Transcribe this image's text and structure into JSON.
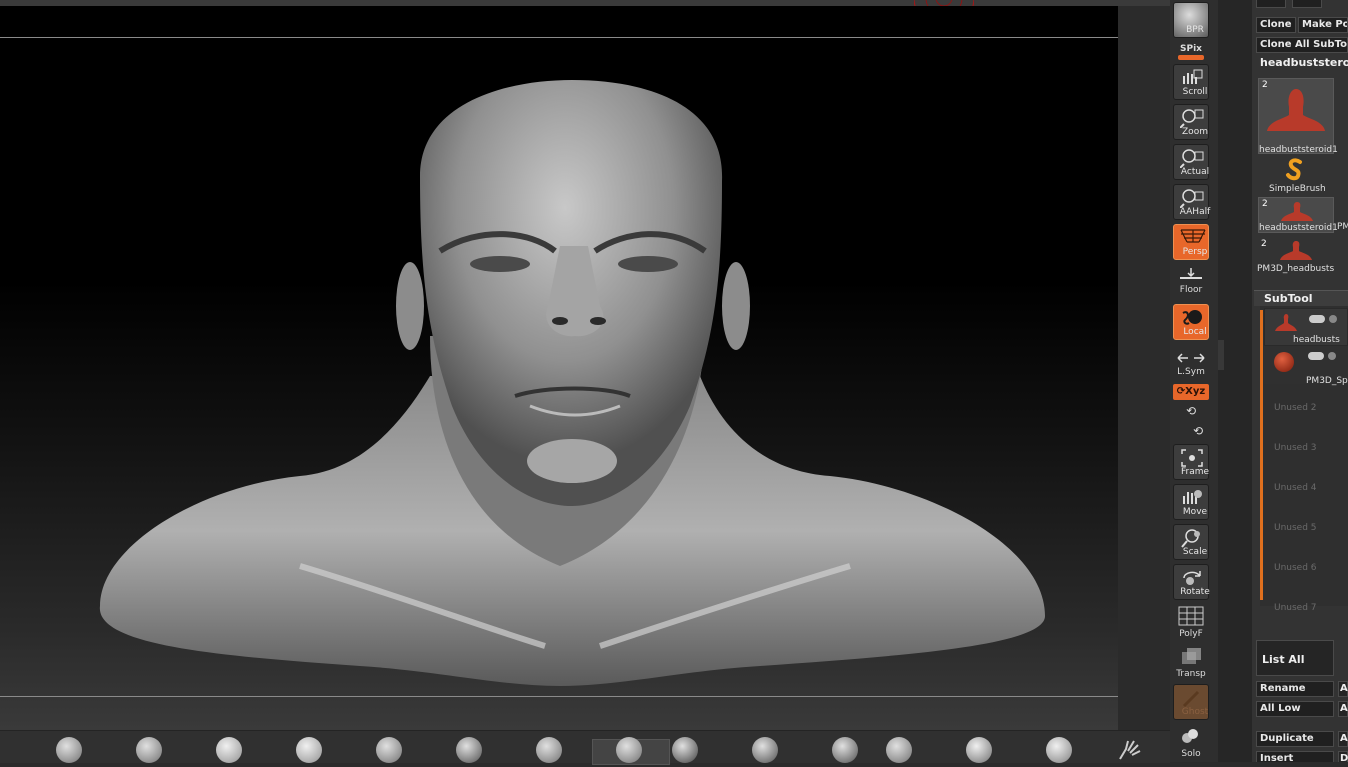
{
  "shelf": {
    "bpr_label": "BPR",
    "spix_label": "SPix",
    "buttons": [
      {
        "label": "Scroll",
        "icon": "scroll-icon"
      },
      {
        "label": "Zoom",
        "icon": "zoom-icon"
      },
      {
        "label": "Actual",
        "icon": "actual-icon"
      },
      {
        "label": "AAHalf",
        "icon": "aahalf-icon"
      },
      {
        "label": "Persp",
        "icon": "perspective-icon",
        "active": true
      },
      {
        "label": "Floor",
        "icon": "floor-icon"
      },
      {
        "label": "Local",
        "icon": "local-icon",
        "active": true
      },
      {
        "label": "L.Sym",
        "icon": "lsym-icon"
      },
      {
        "label": "Xyz",
        "icon": "xyz-icon",
        "active": true
      },
      {
        "label": "Frame",
        "icon": "frame-icon"
      },
      {
        "label": "Move",
        "icon": "move-icon"
      },
      {
        "label": "Scale",
        "icon": "scale-icon"
      },
      {
        "label": "Rotate",
        "icon": "rotate-icon"
      },
      {
        "label": "PolyF",
        "icon": "polyf-icon"
      },
      {
        "label": "Transp",
        "icon": "transp-icon"
      },
      {
        "label": "Ghost",
        "icon": "ghost-icon"
      },
      {
        "label": "Solo",
        "icon": "solo-icon"
      }
    ]
  },
  "tool_panel": {
    "clone_label": "Clone",
    "make_poly_label": "Make Po",
    "clone_all_label": "Clone  All  SubTo",
    "current_tool": "headbuststeroi",
    "tools": [
      {
        "name": "headbuststeroid1",
        "count": "2"
      },
      {
        "name": "SimpleBrush",
        "count": ""
      },
      {
        "name": "headbuststeroid1",
        "count": "2",
        "extra": "PM"
      },
      {
        "name": "PM3D_headbusts",
        "count": "2"
      }
    ]
  },
  "subtool": {
    "title": "SubTool",
    "items": [
      {
        "name": "headbusts",
        "type": "head"
      },
      {
        "name": "PM3D_Sp",
        "type": "sphere"
      }
    ],
    "unused": [
      "Unused  2",
      "Unused  3",
      "Unused  4",
      "Unused  5",
      "Unused  6",
      "Unused  7"
    ],
    "list_all_label": "List  All",
    "rename_label": "Rename",
    "all_low_label": "All  Low",
    "duplicate_label": "Duplicate",
    "insert_label": "Insert",
    "side_a1": "A",
    "side_a2": "A",
    "side_a3": "A",
    "side_d": "D"
  },
  "colors": {
    "accent": "#e8672a",
    "panel_bg": "#333333",
    "canvas_bg": "#000000"
  }
}
